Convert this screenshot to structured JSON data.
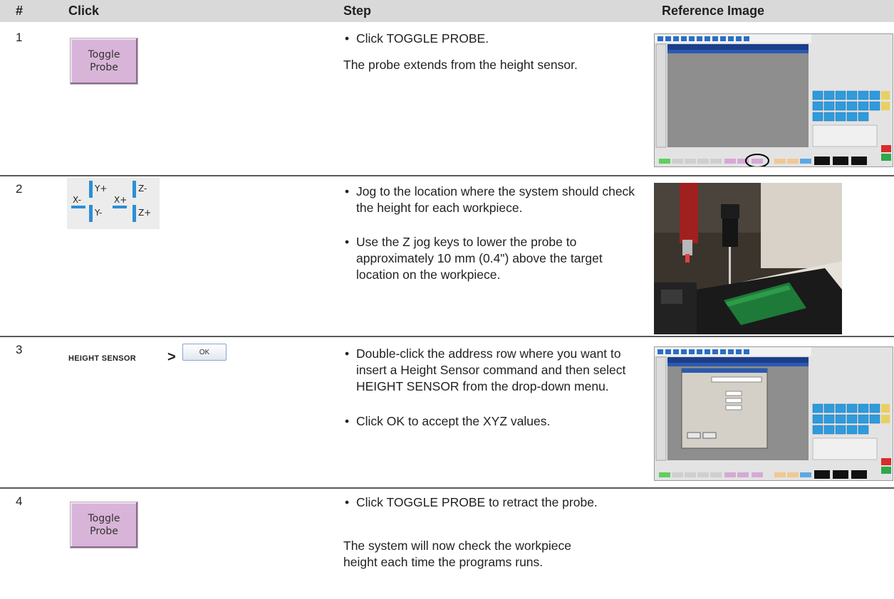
{
  "header": {
    "num_label": "#",
    "click_label": "Click",
    "step_label": "Step",
    "ref_label": "Reference Image"
  },
  "rows": [
    {
      "num": "1",
      "click_button": "Toggle Probe",
      "steps": [
        "Click TOGGLE PROBE."
      ],
      "note": "The probe extends from the height sensor.",
      "image": "software-screenshot-toggle-probe-circled"
    },
    {
      "num": "2",
      "jog_keys": [
        "X-",
        "Y+",
        "Y-",
        "X+",
        "Z-",
        "Z+"
      ],
      "steps": [
        "Jog to the location where the system should check the height for each workpiece.",
        "Use the Z jog keys to lower the probe to approximately 10 mm (0.4\") above the target location on the workpiece."
      ],
      "image": "photo-dispensing-probe-over-circuit-board"
    },
    {
      "num": "3",
      "click_label": "HEIGHT SENSOR",
      "click_sep": ">",
      "ok_button": "OK",
      "steps": [
        "Double-click the address row where you want to insert a Height Sensor command and then select HEIGHT SENSOR from the drop-down menu.",
        "Click OK to accept the XYZ values."
      ],
      "image": "software-screenshot-height-sensor-dialog"
    },
    {
      "num": "4",
      "click_button": "Toggle Probe",
      "steps": [
        "Click TOGGLE PROBE to retract the probe."
      ],
      "note": "The system will now check the workpiece height each time the programs runs."
    }
  ],
  "colors": {
    "header_bg": "#d9d9d9",
    "probe_button": "#d9b4d9",
    "jog_arrow": "#2b8fd6",
    "rule": "#5a5a5a"
  }
}
